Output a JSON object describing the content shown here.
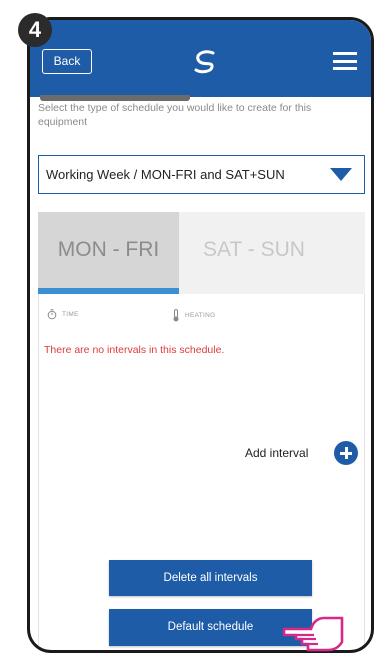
{
  "step": {
    "number": "4"
  },
  "header": {
    "back_label": "Back",
    "logo_icon": "salus-logo-icon",
    "menu_icon": "hamburger-menu-icon",
    "background": "#1f5ca8"
  },
  "schedule_type": {
    "description": "Select the type of schedule you would like to create for this equipment",
    "selected_value": "Working Week / MON-FRI and SAT+SUN"
  },
  "tabs": [
    {
      "label": "MON - FRI",
      "active": true
    },
    {
      "label": "SAT - SUN",
      "active": false
    }
  ],
  "columns": {
    "time_label": "TIME",
    "time_icon": "stopwatch-icon",
    "heating_label": "HEATING",
    "heating_icon": "thermometer-icon"
  },
  "messages": {
    "empty_schedule": "There are no intervals in this schedule."
  },
  "actions": {
    "add_interval_label": "Add interval",
    "delete_all_label": "Delete all intervals",
    "default_schedule_label": "Default schedule"
  },
  "colors": {
    "accent": "#1f5ca8",
    "tab_indicator": "#3b8fd4",
    "error_text": "#e23a3a",
    "pointer_hand": "#d6288a"
  }
}
